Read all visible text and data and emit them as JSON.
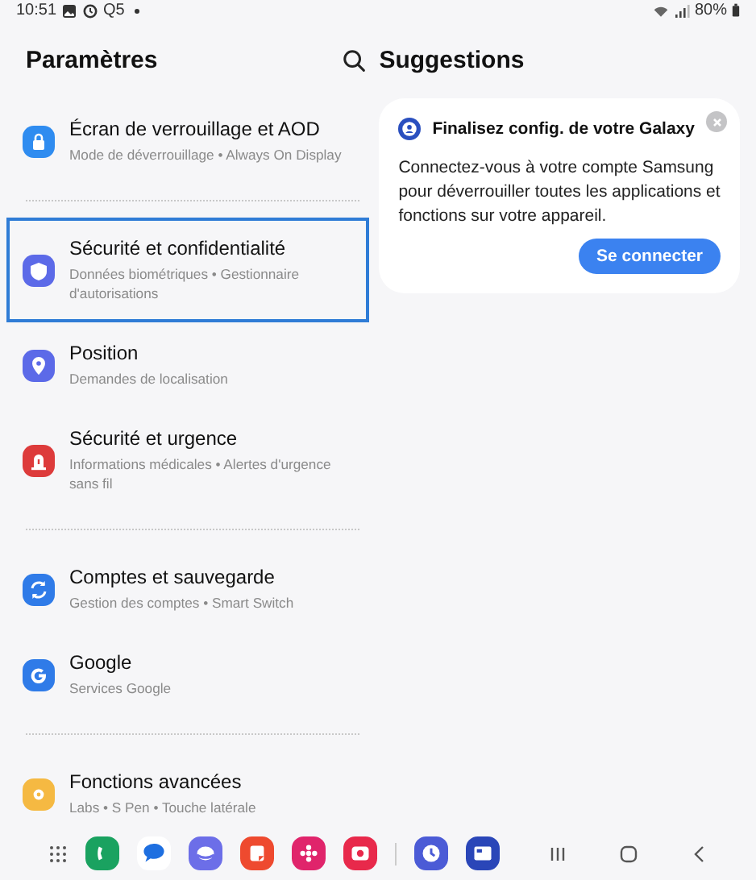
{
  "status_bar": {
    "time": "10:51",
    "notification": "Q5",
    "battery": "80%"
  },
  "settings": {
    "title": "Paramètres",
    "groups": [
      {
        "items": [
          {
            "title": "Écran de verrouillage et AOD",
            "subtitle": "Mode de déverrouillage  •  Always On Display",
            "color": "#2f8cf0",
            "selected": false
          }
        ]
      },
      {
        "items": [
          {
            "title": "Sécurité et confidentialité",
            "subtitle": "Données biométriques  •  Gestionnaire d'autorisations",
            "color": "#5c6ae8",
            "selected": true
          },
          {
            "title": "Position",
            "subtitle": "Demandes de localisation",
            "color": "#5c6ae8",
            "selected": false
          },
          {
            "title": "Sécurité et urgence",
            "subtitle": "Informations médicales  •  Alertes d'urgence sans fil",
            "color": "#dd3b3b",
            "selected": false
          }
        ]
      },
      {
        "items": [
          {
            "title": "Comptes et sauvegarde",
            "subtitle": "Gestion des comptes  •  Smart Switch",
            "color": "#2f7be8",
            "selected": false
          },
          {
            "title": "Google",
            "subtitle": "Services Google",
            "color": "#2f7be8",
            "selected": false
          }
        ]
      },
      {
        "items": [
          {
            "title": "Fonctions avancées",
            "subtitle": "Labs  •  S Pen  •  Touche latérale",
            "color": "#f5b942",
            "selected": false
          }
        ]
      }
    ]
  },
  "suggestions": {
    "title": "Suggestions",
    "card": {
      "title": "Finalisez config. de votre Galaxy",
      "body": "Connectez-vous à votre compte Samsung pour déverrouiller toutes les applications et fonctions sur votre appareil.",
      "button": "Se connecter"
    }
  },
  "taskbar": {
    "apps": [
      {
        "color": "#1aa260"
      },
      {
        "color": "#1e6fe0"
      },
      {
        "color": "#6c6ee8"
      },
      {
        "color": "#ee4a2f"
      },
      {
        "color": "#e0246b"
      },
      {
        "color": "#e8294b"
      }
    ],
    "recent_apps": [
      {
        "color": "#4b5bd6"
      },
      {
        "color": "#2a46b8"
      }
    ]
  }
}
